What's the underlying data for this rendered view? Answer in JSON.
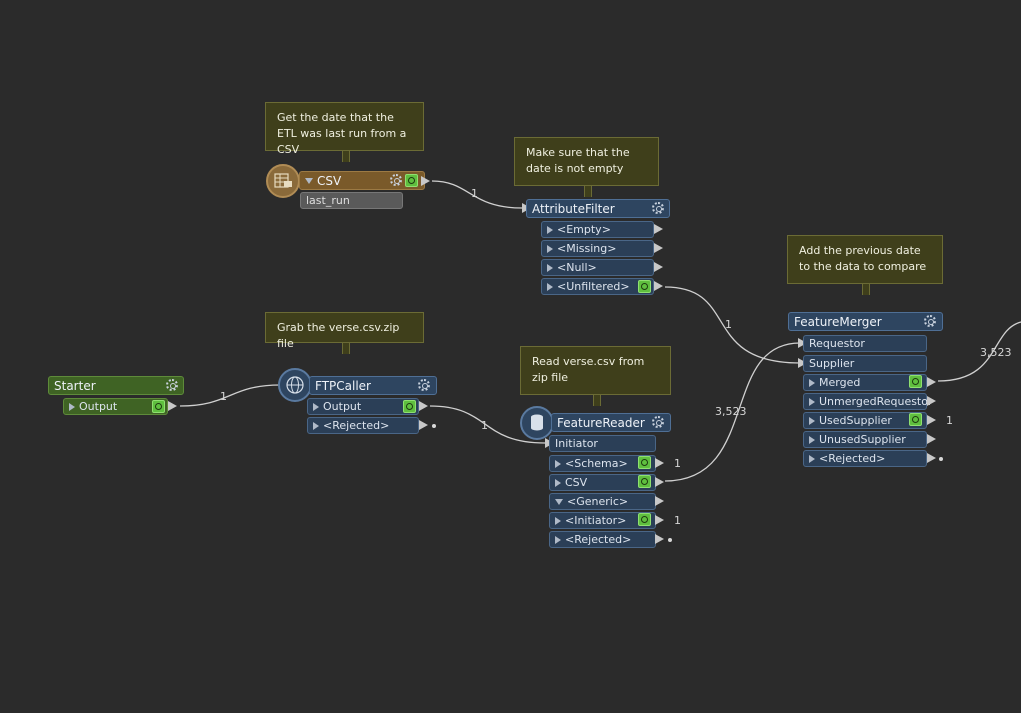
{
  "notes": {
    "csv_note": "Get the date that the ETL was last run from a CSV",
    "filter_note": "Make sure that the date is not empty",
    "ftp_note": "Grab the verse.csv.zip file",
    "reader_note": "Read verse.csv from zip file",
    "merger_note": "Add the previous date to the data to compare"
  },
  "csv_reader": {
    "title": "CSV",
    "attr": "last_run"
  },
  "attribute_filter": {
    "title": "AttributeFilter",
    "ports": [
      "<Empty>",
      "<Missing>",
      "<Null>",
      "<Unfiltered>"
    ]
  },
  "starter": {
    "title": "Starter",
    "port": "Output"
  },
  "ftp_caller": {
    "title": "FTPCaller",
    "ports": [
      "Output",
      "<Rejected>"
    ]
  },
  "feature_reader": {
    "title": "FeatureReader",
    "input": "Initiator",
    "ports": [
      "<Schema>",
      "CSV",
      "<Generic>",
      "<Initiator>",
      "<Rejected>"
    ]
  },
  "feature_merger": {
    "title": "FeatureMerger",
    "inputs": [
      "Requestor",
      "Supplier"
    ],
    "ports": [
      "Merged",
      "UnmergedRequestor",
      "UsedSupplier",
      "UnusedSupplier",
      "<Rejected>"
    ]
  },
  "counts": {
    "csv_to_filter": "1",
    "starter_to_ftp": "1",
    "ftp_to_reader": "1",
    "filter_to_merger": "1",
    "reader_to_merger": "3,523",
    "schema": "1",
    "initiator": "1",
    "used_supplier": "1",
    "merged_out": "3,523"
  }
}
